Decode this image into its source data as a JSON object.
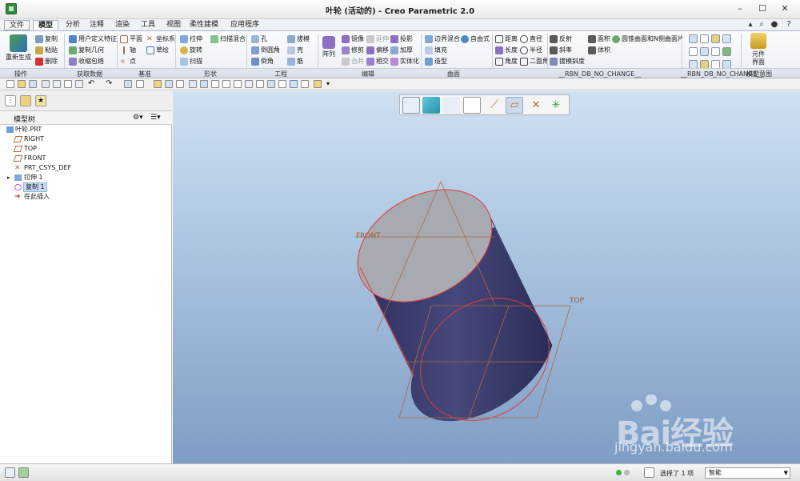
{
  "window": {
    "title": "叶轮 (活动的) - Creo Parametric 2.0"
  },
  "tabs": [
    {
      "label": "文件",
      "id": "file"
    },
    {
      "label": "模型",
      "id": "model"
    },
    {
      "label": "分析",
      "id": "analysis"
    },
    {
      "label": "注释",
      "id": "annotate"
    },
    {
      "label": "渲染",
      "id": "render"
    },
    {
      "label": "工具",
      "id": "tools"
    },
    {
      "label": "视图",
      "id": "view"
    },
    {
      "label": "柔性建模",
      "id": "flex"
    },
    {
      "label": "应用程序",
      "id": "apps"
    }
  ],
  "ribbon": {
    "regenerate": "重新生成",
    "copy": "复制",
    "paste": "粘贴",
    "delete": "删除",
    "udf": "用户定义特征",
    "copy_geom": "复制几何",
    "shrinkwrap": "收缩包络",
    "plane": "平面",
    "axis": "轴",
    "point": "点",
    "csys": "坐标系",
    "sketch": "草绘",
    "extrude": "拉伸",
    "revolve": "旋转",
    "sweep": "扫描",
    "swept_blend": "扫描混合",
    "hole": "孔",
    "round": "倒圆角",
    "chamfer": "倒角",
    "draft": "拔模",
    "shell": "壳",
    "rib": "筋",
    "pattern": "阵列",
    "mirror": "镜像",
    "trim": "修剪",
    "merge": "合并",
    "extend": "延伸",
    "offset": "偏移",
    "intersect": "相交",
    "project": "投影",
    "thicken": "加厚",
    "solidify": "实体化",
    "boundary_blend": "边界混合",
    "freestyle": "自由式",
    "fill": "填充",
    "style": "造型",
    "distance": "距离",
    "length": "长度",
    "angle": "角度",
    "diameter": "直径",
    "radius": "半径",
    "dihedral": "二面角",
    "reflection": "反射",
    "slope": "斜率",
    "draft_slope": "拔模斜度",
    "area": "面积",
    "volume": "体积",
    "curvature_surface": "圆锥曲面和N侧曲面片",
    "part_interface": "元件\n界面"
  },
  "groups": {
    "operations": "操作",
    "get_data": "获取数据",
    "datum": "基准",
    "shapes": "形状",
    "engineering": "工程",
    "editing": "编辑",
    "surfaces": "曲面",
    "rbn1": "__RBN_DB_NO_CHANGE__",
    "rbn2": "__RBN_DB_NO_CHANGE__",
    "model_intent": "模型意图"
  },
  "model_tree": {
    "title": "模型树",
    "items": [
      {
        "label": "叶轮.PRT",
        "icon": "part-icon"
      },
      {
        "label": "RIGHT",
        "icon": "datum-plane-icon"
      },
      {
        "label": "TOP",
        "icon": "datum-plane-icon"
      },
      {
        "label": "FRONT",
        "icon": "datum-plane-icon"
      },
      {
        "label": "PRT_CSYS_DEF",
        "icon": "csys-icon"
      },
      {
        "label": "拉伸 1",
        "icon": "extrude-icon"
      },
      {
        "label": "复制 1",
        "icon": "copy-feature-icon"
      },
      {
        "label": "在此插入",
        "icon": "insert-here-icon"
      }
    ]
  },
  "viewport": {
    "datum_labels": {
      "front": "FRONT",
      "top": "TOP"
    }
  },
  "watermark": {
    "brand": "Bai经验",
    "url": "jingyan.baidu.com"
  },
  "status": {
    "selected": "选择了 1 项",
    "filter": "智能"
  },
  "colors": {
    "viewport_top": "#cfe0f2",
    "viewport_bottom": "#7f9dc5",
    "solid": "#3d3f6b",
    "cap": "#a7aab0",
    "edge": "#e23a3a",
    "datum": "#b06a3c"
  }
}
